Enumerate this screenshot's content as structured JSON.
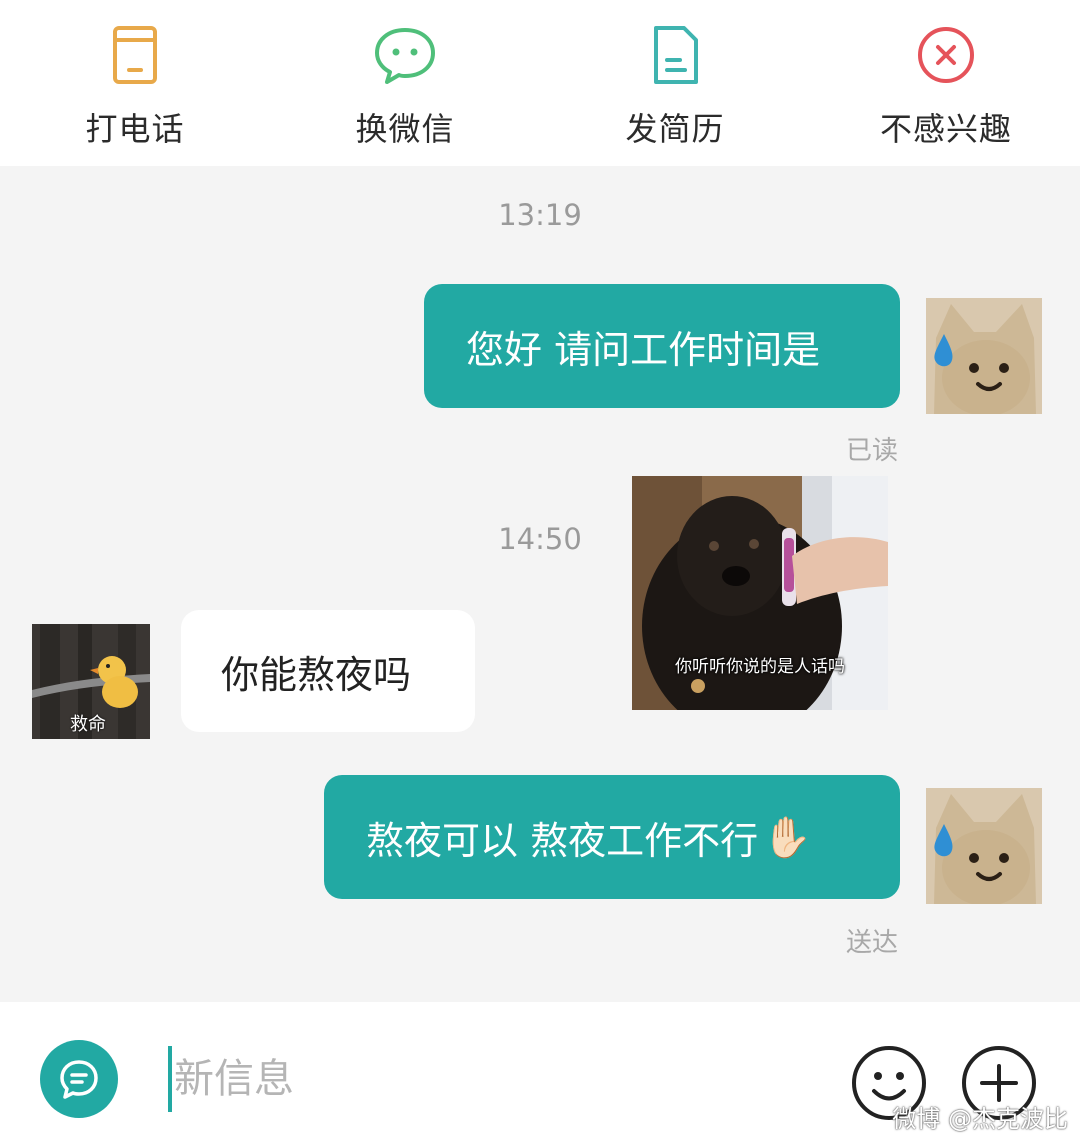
{
  "actions": [
    {
      "label": "打电话",
      "icon": "phone-icon",
      "color": "#e8a94a"
    },
    {
      "label": "换微信",
      "icon": "wechat-icon",
      "color": "#4fbf7a"
    },
    {
      "label": "发简历",
      "icon": "resume-icon",
      "color": "#3fb4b0"
    },
    {
      "label": "不感兴趣",
      "icon": "close-circle-icon",
      "color": "#e5535a"
    }
  ],
  "chat": {
    "messages": [
      {
        "time": "13:19"
      },
      {
        "from": "me",
        "text": "您好 请问工作时间是",
        "status": "已读"
      },
      {
        "time": "14:50"
      },
      {
        "from": "me",
        "type": "image",
        "caption": "你听听你说的是人话吗"
      },
      {
        "from": "other",
        "text": "你能熬夜吗",
        "avatar_caption": "救命"
      },
      {
        "from": "me",
        "text": "熬夜可以 熬夜工作不行",
        "emoji": "✋🏻",
        "status": "送达"
      }
    ]
  },
  "input": {
    "placeholder": "新信息"
  },
  "watermark": "微博 @杰克波比",
  "colors": {
    "accent": "#22a9a3",
    "background": "#f4f4f4"
  }
}
